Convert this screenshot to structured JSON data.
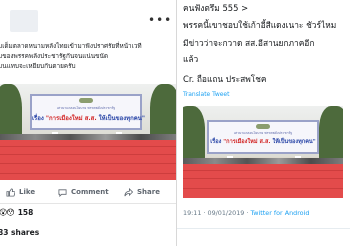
{
  "facebook": {
    "post_text": [
      "มเต็มตลาดหนามหลังไทยเข้ามาฟังปราศรัยที่หน้าเวที",
      "มของพรรคพลังประชารัฐกันจนแน่นขนัด",
      "มนแทบจะเหยียบกันตายครับ"
    ],
    "banner": {
      "subtitle": "เสวนาแถลงนโยบาย พรรคพลังประชารัฐ",
      "title_prefix": "เรื่อง",
      "title_highlight": "\"การเมืองใหม่ ส.ส.",
      "title_suffix": "ให้เป็นของทุกคน\""
    },
    "actions": {
      "like": "Like",
      "comment": "Comment",
      "share": "Share"
    },
    "reactions": {
      "icons": "😮😯",
      "count": "158"
    },
    "shares": "83 shares"
  },
  "twitter": {
    "lines": [
      "คนฟังตรึม 555 >",
      "พรรคนี้เขาชอบใช้เก้าอี้สีแดงเนาะ ชัวร์ไหม",
      "มีข่าวว่าจะกวาด สส.อีสานยกภาคอีก",
      "แล้ว",
      "Cr. ถือแถน ประสพโชค"
    ],
    "translate": "Translate Tweet",
    "banner": {
      "subtitle": "เสวนาแถลงนโยบาย พรรคพลังประชารัฐ",
      "title_prefix": "เรื่อง",
      "title_highlight": "\"การเมืองใหม่ ส.ส.",
      "title_suffix": "ให้เป็นของทุกคน\""
    },
    "time": "19:11 · 09/01/2019 · ",
    "source": "Twitter for Android"
  },
  "colors": {
    "crowd_red": "#e34b4b",
    "banner_blue": "#2b47a8",
    "banner_red": "#d22424",
    "twitter_blue": "#1da1f2"
  }
}
